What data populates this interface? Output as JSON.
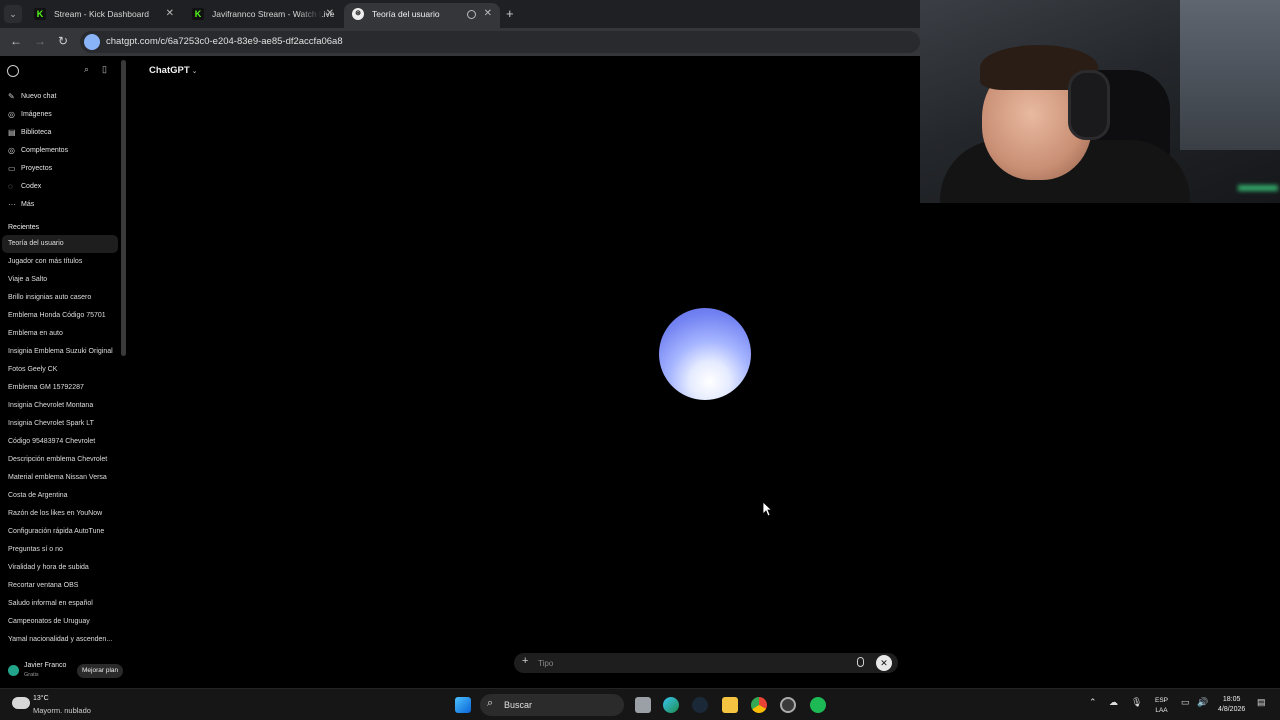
{
  "browser": {
    "tabs": [
      {
        "title": "Stream - Kick Dashboard",
        "favicon": "kick-icon"
      },
      {
        "title": "Javifrannco Stream - Watch Live",
        "favicon": "kick-icon"
      },
      {
        "title": "Teoría del usuario",
        "favicon": "chatgpt-icon",
        "active": true
      }
    ],
    "url": "chatgpt.com/c/6a7253c0-e204-83e9-ae85-df2accfa06a8"
  },
  "sidebar": {
    "nav": [
      {
        "label": "Nuevo chat",
        "icon": "edit-icon"
      },
      {
        "label": "Imágenes",
        "icon": "image-icon"
      },
      {
        "label": "Biblioteca",
        "icon": "library-icon"
      },
      {
        "label": "Complementos",
        "icon": "plugin-icon"
      },
      {
        "label": "Proyectos",
        "icon": "folder-icon"
      },
      {
        "label": "Codex",
        "icon": "codex-icon"
      },
      {
        "label": "Más",
        "icon": "more-icon"
      }
    ],
    "recent_heading": "Recientes",
    "recent": [
      "Teoría del usuario",
      "Jugador con más títulos",
      "Viaje a Salto",
      "Brillo insignias auto casero",
      "Emblema Honda Código 75701",
      "Emblema en auto",
      "Insignia Emblema Suzuki Original",
      "Fotos Geely CK",
      "Emblema GM 15792287",
      "Insignia Chevrolet Montana",
      "Insignia Chevrolet Spark LT",
      "Código 95483974 Chevrolet",
      "Descripción emblema Chevrolet",
      "Material emblema Nissan Versa",
      "Costa de Argentina",
      "Razón de los likes en YouNow",
      "Configuración rápida AutoTune",
      "Preguntas sí o no",
      "Viralidad y hora de subida",
      "Recortar ventana OBS",
      "Saludo informal en español",
      "Campeonatos de Uruguay",
      "Yamal nacionalidad y ascenden..."
    ],
    "user": {
      "name": "Javier Franco",
      "plan": "Gratis",
      "upgrade_label": "Mejorar plan"
    }
  },
  "main": {
    "model_label": "ChatGPT",
    "composer_placeholder": "Tipo"
  },
  "taskbar": {
    "weather_temp": "13°C",
    "weather_desc": "Mayorm. nublado",
    "search_label": "Buscar",
    "lang_line1": "ESP",
    "lang_line2": "LAA",
    "time": "18:05",
    "date": "4/8/2026"
  },
  "colors": {
    "orb_top": "#5b6ae8",
    "kick_green": "#53fc18",
    "avatar": "#22a58a"
  }
}
